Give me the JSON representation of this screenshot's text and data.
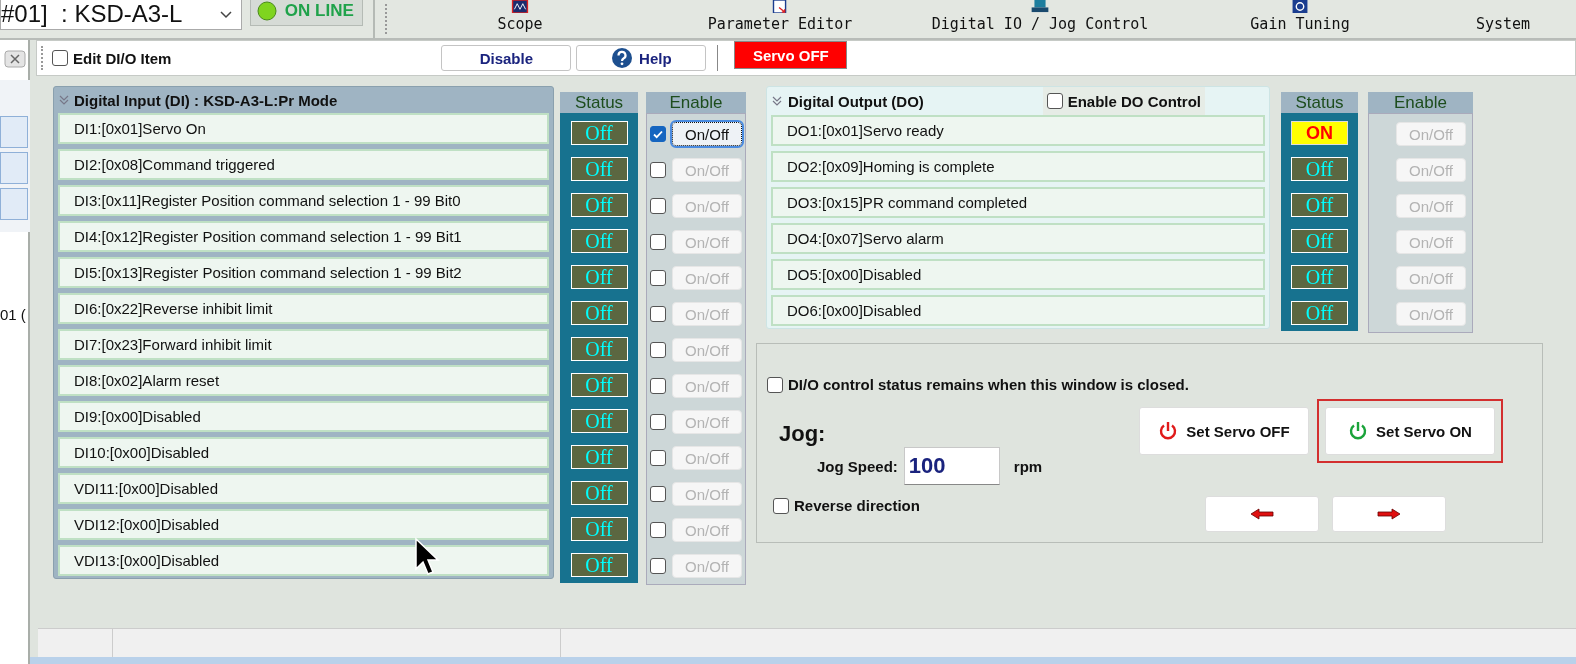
{
  "device_selector": {
    "value": "#01]  : KSD-A3-L"
  },
  "connection": {
    "label": "ON LINE",
    "online": true
  },
  "toolbar": [
    {
      "label": "Scope",
      "kind": "scope"
    },
    {
      "label": "Parameter Editor",
      "kind": "editor"
    },
    {
      "label": "Digital IO / Jog Control",
      "kind": "io"
    },
    {
      "label": "Gain Tuning",
      "kind": "gain"
    },
    {
      "label": "System",
      "kind": "system"
    }
  ],
  "side_strip": {
    "text": "01 ("
  },
  "edit_bar": {
    "edit_item": {
      "label": "Edit DI/O Item",
      "checked": false
    },
    "buttons": [
      {
        "label": "Disable",
        "kind": "plain"
      },
      {
        "label": "Help",
        "kind": "help"
      }
    ],
    "servo_status": {
      "label": "Servo OFF",
      "on": false
    }
  },
  "digital_input": {
    "title": "Digital Input (DI) : KSD-A3-L:Pr Mode",
    "status_header": "Status",
    "enable_header": "Enable",
    "items": [
      {
        "label": "DI1:[0x01]Servo On",
        "status": "Off",
        "on": false,
        "checked": true,
        "toggle": "On/Off"
      },
      {
        "label": "DI2:[0x08]Command triggered",
        "status": "Off",
        "on": false,
        "checked": false,
        "toggle": "On/Off"
      },
      {
        "label": "DI3:[0x11]Register Position command selection 1 - 99 Bit0",
        "status": "Off",
        "on": false,
        "checked": false,
        "toggle": "On/Off"
      },
      {
        "label": "DI4:[0x12]Register Position command selection 1 - 99 Bit1",
        "status": "Off",
        "on": false,
        "checked": false,
        "toggle": "On/Off"
      },
      {
        "label": "DI5:[0x13]Register Position command selection 1 - 99 Bit2",
        "status": "Off",
        "on": false,
        "checked": false,
        "toggle": "On/Off"
      },
      {
        "label": "DI6:[0x22]Reverse inhibit limit",
        "status": "Off",
        "on": false,
        "checked": false,
        "toggle": "On/Off"
      },
      {
        "label": "DI7:[0x23]Forward inhibit limit",
        "status": "Off",
        "on": false,
        "checked": false,
        "toggle": "On/Off"
      },
      {
        "label": "DI8:[0x02]Alarm reset",
        "status": "Off",
        "on": false,
        "checked": false,
        "toggle": "On/Off"
      },
      {
        "label": "DI9:[0x00]Disabled",
        "status": "Off",
        "on": false,
        "checked": false,
        "toggle": "On/Off"
      },
      {
        "label": "DI10:[0x00]Disabled",
        "status": "Off",
        "on": false,
        "checked": false,
        "toggle": "On/Off"
      },
      {
        "label": "VDI11:[0x00]Disabled",
        "status": "Off",
        "on": false,
        "checked": false,
        "toggle": "On/Off"
      },
      {
        "label": "VDI12:[0x00]Disabled",
        "status": "Off",
        "on": false,
        "checked": false,
        "toggle": "On/Off"
      },
      {
        "label": "VDI13:[0x00]Disabled",
        "status": "Off",
        "on": false,
        "checked": false,
        "toggle": "On/Off"
      }
    ]
  },
  "digital_output": {
    "title": "Digital Output (DO)",
    "enable_control": {
      "label": "Enable DO Control",
      "checked": false
    },
    "status_header": "Status",
    "enable_header": "Enable",
    "items": [
      {
        "label": "DO1:[0x01]Servo ready",
        "status": "ON",
        "on": true,
        "toggle": "On/Off"
      },
      {
        "label": "DO2:[0x09]Homing is complete",
        "status": "Off",
        "on": false,
        "toggle": "On/Off"
      },
      {
        "label": "DO3:[0x15]PR command completed",
        "status": "Off",
        "on": false,
        "toggle": "On/Off"
      },
      {
        "label": "DO4:[0x07]Servo alarm",
        "status": "Off",
        "on": false,
        "toggle": "On/Off"
      },
      {
        "label": "DO5:[0x00]Disabled",
        "status": "Off",
        "on": false,
        "toggle": "On/Off"
      },
      {
        "label": "DO6:[0x00]Disabled",
        "status": "Off",
        "on": false,
        "toggle": "On/Off"
      }
    ]
  },
  "control": {
    "keep_status": {
      "label": "DI/O control status remains when this window is closed.",
      "checked": false
    },
    "jog": {
      "title": "Jog:",
      "speed_label": "Jog Speed:",
      "speed_value": "100",
      "unit": "rpm",
      "reverse": {
        "label": "Reverse direction",
        "checked": false
      }
    },
    "servo_buttons": [
      {
        "label": "Set Servo OFF",
        "kind": "off",
        "highlighted": false
      },
      {
        "label": "Set Servo ON",
        "kind": "on",
        "highlighted": true
      }
    ],
    "jog_buttons": [
      {
        "kind": "left"
      },
      {
        "kind": "right"
      }
    ]
  }
}
